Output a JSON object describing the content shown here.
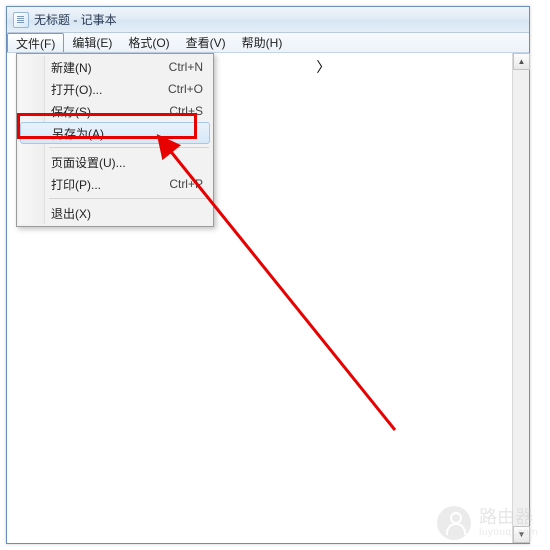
{
  "window": {
    "title": "无标题 - 记事本"
  },
  "menubar": {
    "items": [
      {
        "label": "文件(F)",
        "active": true
      },
      {
        "label": "编辑(E)",
        "active": false
      },
      {
        "label": "格式(O)",
        "active": false
      },
      {
        "label": "查看(V)",
        "active": false
      },
      {
        "label": "帮助(H)",
        "active": false
      }
    ]
  },
  "dropdown": {
    "items": [
      {
        "label": "新建(N)",
        "shortcut": "Ctrl+N",
        "highlighted": false
      },
      {
        "label": "打开(O)...",
        "shortcut": "Ctrl+O",
        "highlighted": false
      },
      {
        "label": "保存(S)",
        "shortcut": "Ctrl+S",
        "highlighted": false
      },
      {
        "label": "另存为(A)...",
        "shortcut": "",
        "highlighted": true
      },
      {
        "sep": true
      },
      {
        "label": "页面设置(U)...",
        "shortcut": "",
        "highlighted": false
      },
      {
        "label": "打印(P)...",
        "shortcut": "Ctrl+P",
        "highlighted": false
      },
      {
        "sep": true
      },
      {
        "label": "退出(X)",
        "shortcut": "",
        "highlighted": false
      }
    ]
  },
  "content": {
    "text": "                                    〉"
  },
  "watermark": {
    "title": "路由器",
    "sub": "luyouqi.com"
  }
}
